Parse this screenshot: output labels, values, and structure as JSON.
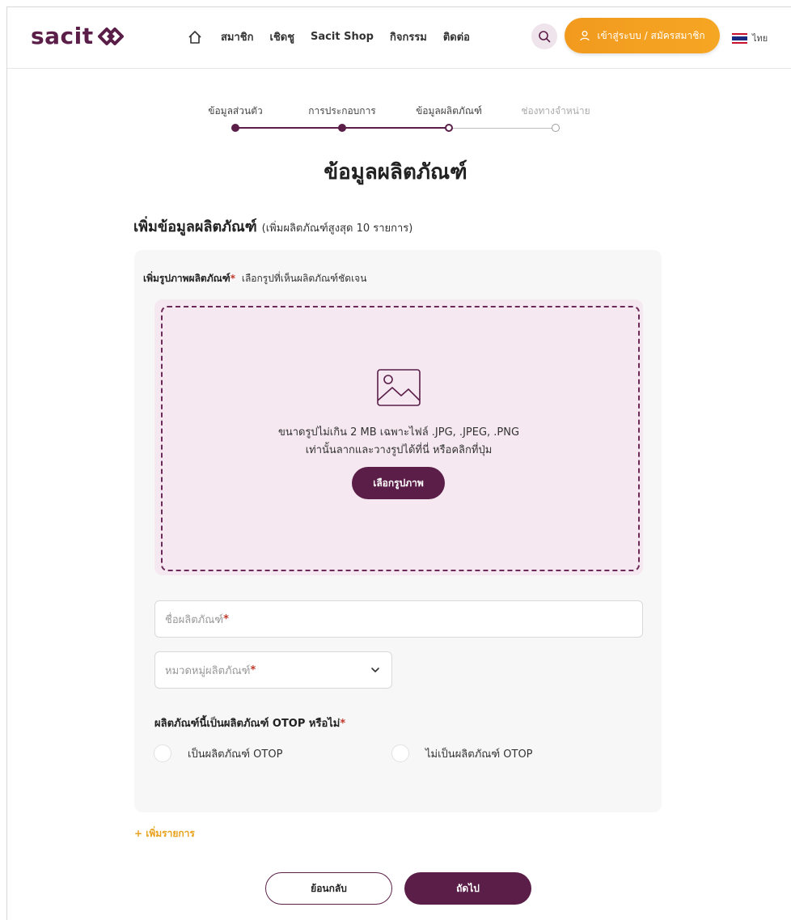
{
  "header": {
    "logo_text": "sacit",
    "nav": [
      "สมาชิก",
      "เชิดชู",
      "Sacit Shop",
      "กิจกรรม",
      "ติดต่อ"
    ],
    "login_label": "เข้าสู่ระบบ / สมัครสมาชิก",
    "lang_label": "ไทย"
  },
  "stepper": {
    "steps": [
      {
        "label": "ข้อมูลส่วนตัว",
        "state": "done"
      },
      {
        "label": "การประกอบการ",
        "state": "done"
      },
      {
        "label": "ข้อมูลผลิตภัณฑ์",
        "state": "current"
      },
      {
        "label": "ช่องทางจำหน่าย",
        "state": "todo"
      }
    ]
  },
  "page_title": "ข้อมูลผลิตภัณฑ์",
  "section": {
    "title": "เพิ่มข้อมูลผลิตภัณฑ์",
    "subtitle": "(เพิ่มผลิตภัณฑ์สูงสุด 10 รายการ)"
  },
  "upload": {
    "label": "เพิ่มรูปภาพผลิตภัณฑ์",
    "required_mark": "*",
    "hint": "เลือกรูปที่เห็นผลิตภัณฑ์ชัดเจน",
    "line1": "ขนาดรูปไม่เกิน 2 MB เฉพาะไฟล์ .JPG, .JPEG, .PNG",
    "line2": "เท่านั้นลากและวางรูปได้ที่นี่ หรือคลิกที่ปุ่ม",
    "button": "เลือกรูปภาพ"
  },
  "fields": {
    "product_name_placeholder": "ชื่อผลิตภัณฑ์",
    "category_placeholder": "หมวดหมู่ผลิตภัณฑ์",
    "required_mark": "*"
  },
  "otop": {
    "question": "ผลิตภัณฑ์นี้เป็นผลิตภัณฑ์ OTOP หรือไม่",
    "required_mark": "*",
    "option_yes": "เป็นผลิตภัณฑ์ OTOP",
    "option_no": "ไม่เป็นผลิตภัณฑ์ OTOP"
  },
  "add_more_label": "+ เพิ่มรายการ",
  "actions": {
    "back": "ย้อนกลับ",
    "next": "ถัดไป"
  },
  "colors": {
    "brand": "#5a1e48",
    "accent": "#f29a1e",
    "dropzone_bg": "#f5e8f0",
    "add_more": "#e8a21d"
  }
}
